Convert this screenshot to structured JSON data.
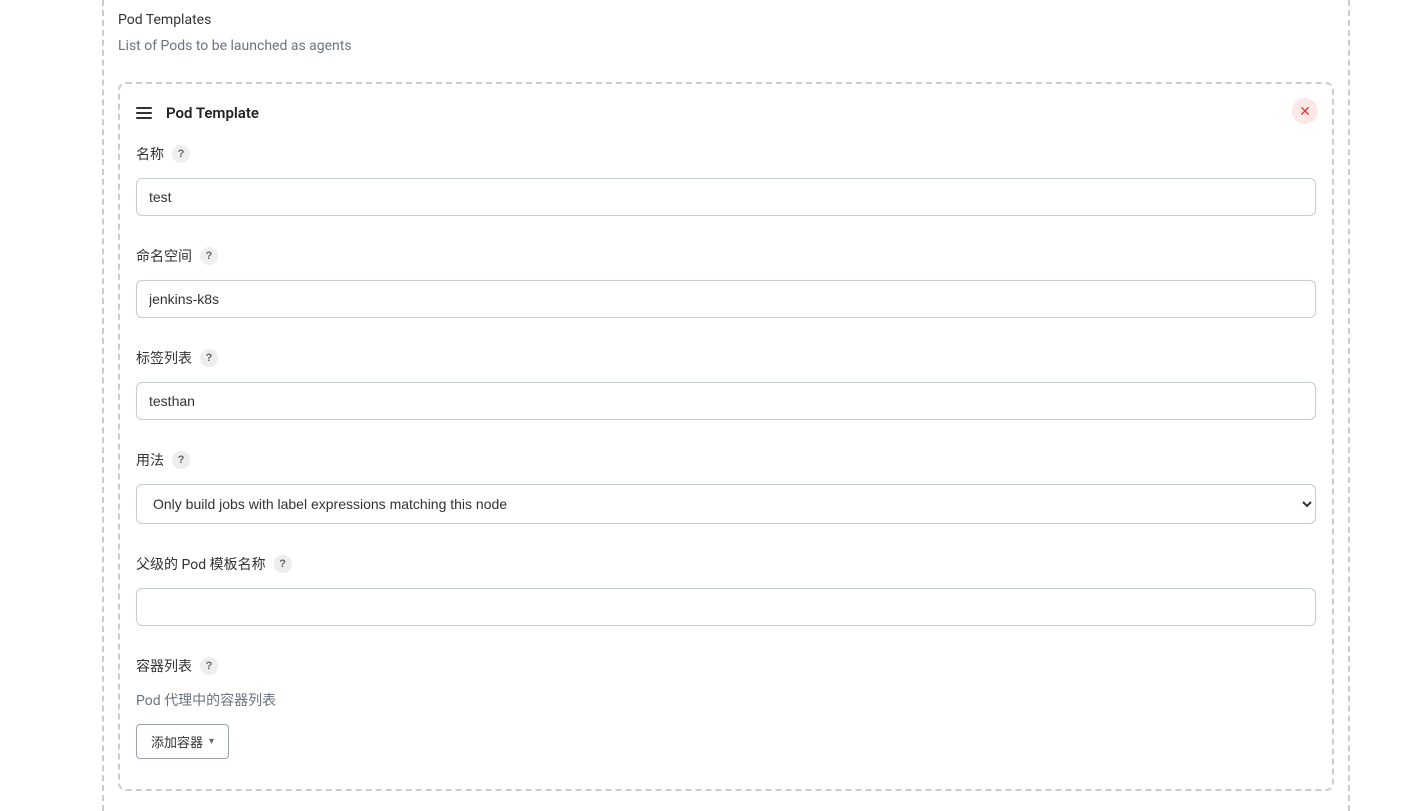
{
  "section": {
    "title": "Pod Templates",
    "description": "List of Pods to be launched as agents"
  },
  "podTemplate": {
    "title": "Pod Template",
    "fields": {
      "name": {
        "label": "名称",
        "value": "test"
      },
      "namespace": {
        "label": "命名空间",
        "value": "jenkins-k8s"
      },
      "labels": {
        "label": "标签列表",
        "value": "testhan"
      },
      "usage": {
        "label": "用法",
        "value": "Only build jobs with label expressions matching this node"
      },
      "parentTemplate": {
        "label": "父级的 Pod 模板名称",
        "value": ""
      },
      "containers": {
        "label": "容器列表",
        "description": "Pod 代理中的容器列表",
        "addButton": "添加容器"
      }
    }
  },
  "helpTooltip": "?"
}
